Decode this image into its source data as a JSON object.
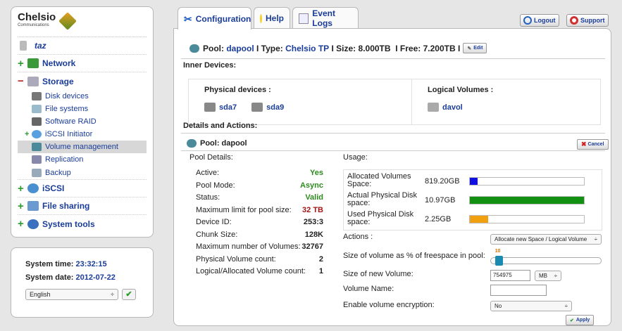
{
  "sidebar": {
    "logo": "Chelsio",
    "logo_sub": "Communications",
    "host": "taz",
    "items": [
      {
        "label": "Network",
        "icon": "network-icon"
      },
      {
        "label": "Storage",
        "icon": "storage-icon"
      },
      {
        "label": "iSCSI",
        "icon": "iscsi-icon"
      },
      {
        "label": "File sharing",
        "icon": "file-sharing-icon"
      },
      {
        "label": "System tools",
        "icon": "system-tools-icon"
      }
    ],
    "storage_children": [
      {
        "label": "Disk devices"
      },
      {
        "label": "File systems"
      },
      {
        "label": "Software RAID"
      },
      {
        "label": "iSCSI Initiator"
      },
      {
        "label": "Volume management"
      },
      {
        "label": "Replication"
      },
      {
        "label": "Backup"
      }
    ]
  },
  "system": {
    "time_label": "System time:",
    "time": "23:32:15",
    "date_label": "System date:",
    "date": "2012-07-22",
    "language": "English"
  },
  "tabs": [
    {
      "label": "Configuration"
    },
    {
      "label": "Help"
    },
    {
      "label": "Event Logs"
    }
  ],
  "header": {
    "logout": "Logout",
    "support": "Support"
  },
  "pool": {
    "prefix": "Pool:",
    "name": "dapool",
    "type_label": "I Type:",
    "type": "Chelsio TP",
    "size_label": "I Size:",
    "size": "8.000TB",
    "free_label": "I  Free:",
    "free": "7.200TB",
    "sep": "I",
    "edit": "Edit"
  },
  "inner": {
    "title": "Inner Devices:",
    "physical_title": "Physical devices :",
    "physical": [
      "sda7",
      "sda9"
    ],
    "logical_title": "Logical Volumes :",
    "logical": [
      "davol"
    ]
  },
  "details": {
    "title": "Details and Actions:",
    "pool_header": "Pool: dapool",
    "cancel": "Cancel",
    "pool_details_title": "Pool Details:",
    "usage_title": "Usage:"
  },
  "pool_details": [
    {
      "label": "Active:",
      "value": "Yes",
      "color": "#2d8a1e"
    },
    {
      "label": "Pool Mode:",
      "value": "Async",
      "color": "#2d8a1e"
    },
    {
      "label": "Status:",
      "value": "Valid",
      "color": "#2d8a1e"
    },
    {
      "label": "Maximum limit for pool size:",
      "value": "32 TB",
      "color": "#a01818"
    },
    {
      "label": "Device ID:",
      "value": "253:3",
      "color": "#222"
    },
    {
      "label": "Chunk Size:",
      "value": "128K",
      "color": "#222"
    },
    {
      "label": "Maximum number of Volumes:",
      "value": "32767",
      "color": "#222"
    },
    {
      "label": "Physical Volume count:",
      "value": "2",
      "color": "#222"
    },
    {
      "label": "Logical/Allocated Volume count:",
      "value": "1",
      "color": "#222"
    }
  ],
  "usage": [
    {
      "label1": "Allocated Volumes",
      "label2": "Space:",
      "value": "819.20GB",
      "fraction": 0.07,
      "color": "#1010e0"
    },
    {
      "label1": "Actual Physical Disk",
      "label2": "space:",
      "value": "10.97GB",
      "fraction": 1.0,
      "color": "#129012"
    },
    {
      "label1": "Used Physical Disk",
      "label2": "space:",
      "value": "2.25GB",
      "fraction": 0.16,
      "color": "#f0a010"
    }
  ],
  "actions": {
    "actions_label": "Actions :",
    "actions_value": "Allocate new Space / Logical Volume",
    "pct_label": "Size of volume as % of freespace in pool:",
    "pct_value": "10",
    "pct_fraction": 0.1,
    "size_label": "Size of new Volume:",
    "size_value": "754975",
    "unit": "MB",
    "name_label": "Volume Name:",
    "name_value": "",
    "enc_label": "Enable volume encryption:",
    "enc_value": "No",
    "apply": "Apply"
  }
}
